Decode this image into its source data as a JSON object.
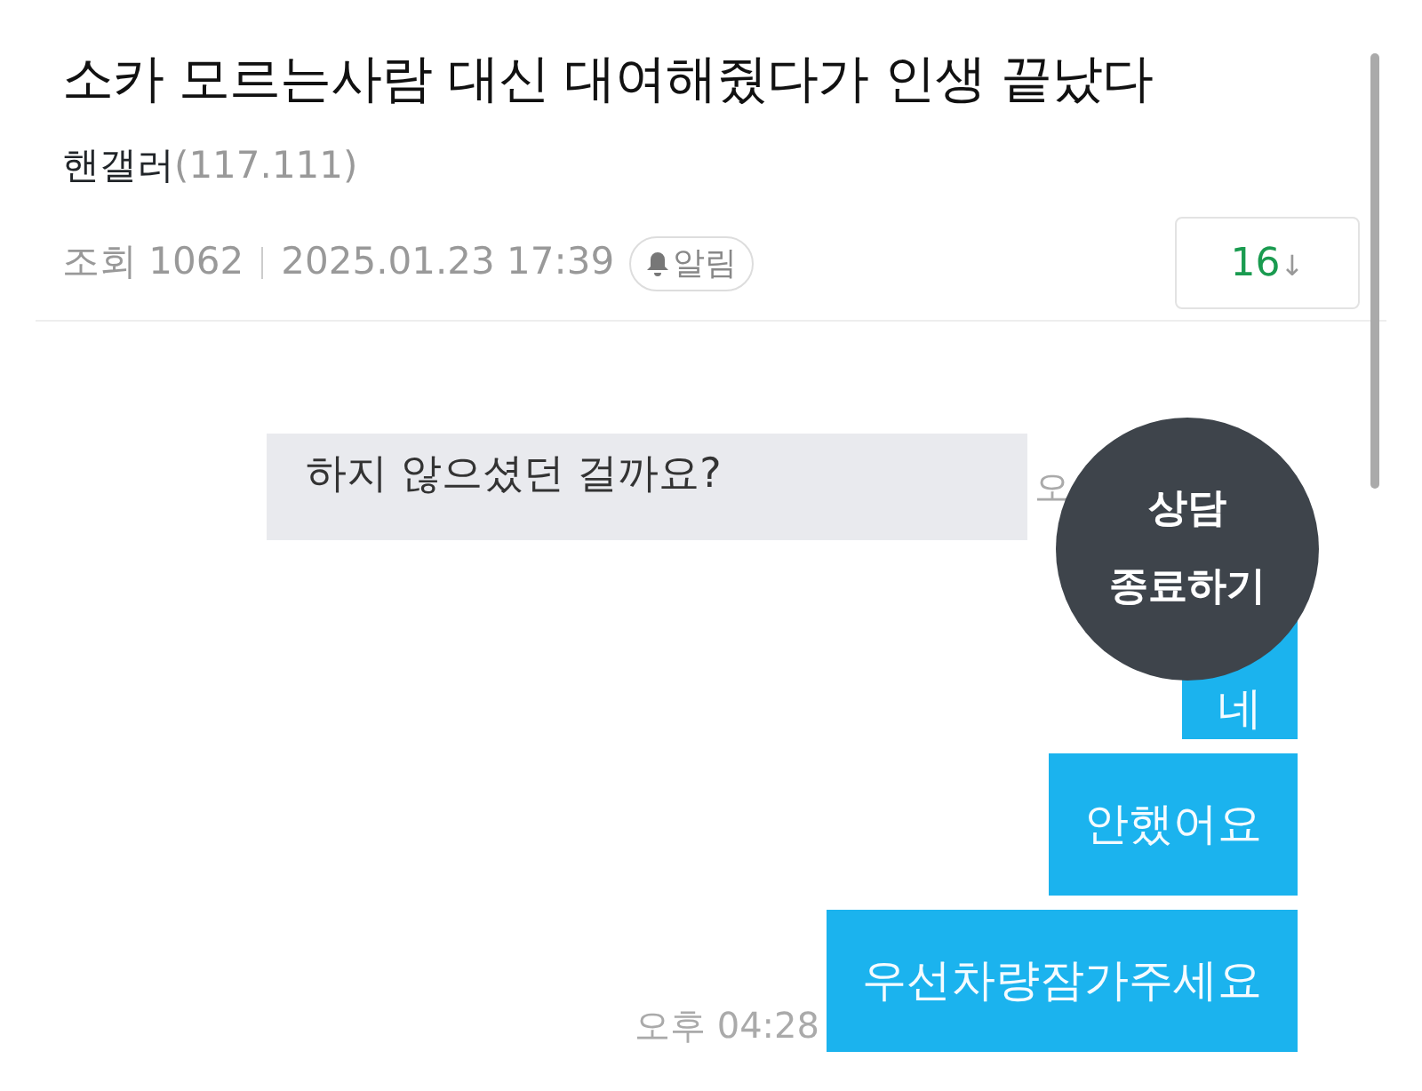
{
  "post": {
    "title": "소카 모르는사람 대신 대여해줬다가 인생 끝났다",
    "author": "핸갤러",
    "ip": "(117.111)",
    "views_label": "조회",
    "views": "1062",
    "date": "2025.01.23 17:39",
    "alert_button": "알림",
    "comment_count": "16",
    "comment_arrow": "↓"
  },
  "chat": {
    "messages": [
      {
        "kind": "received",
        "text": "하지 않으셨던 걸까요?",
        "time": "오"
      },
      {
        "kind": "sent",
        "text": "네"
      },
      {
        "kind": "sent",
        "text": "안했어요"
      },
      {
        "kind": "sent",
        "text": "우선차량잠가주세요",
        "time": "오후 04:28"
      }
    ],
    "overlay_button": {
      "lines": [
        "상담",
        "종료하기"
      ]
    }
  }
}
